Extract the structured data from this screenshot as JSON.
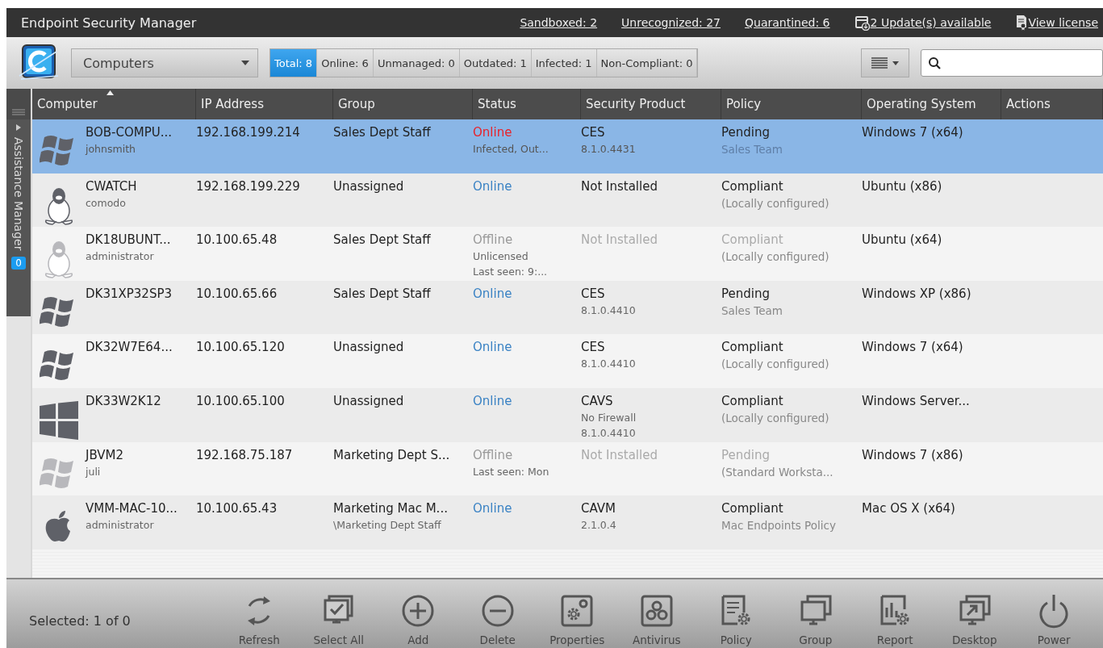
{
  "window": {
    "title": "Endpoint Security Manager"
  },
  "top_links": [
    {
      "kind": "link",
      "label": "Sandboxed: 2"
    },
    {
      "kind": "link",
      "label": "Unrecognized: 27"
    },
    {
      "kind": "link",
      "label": "Quarantined: 6"
    },
    {
      "kind": "updates",
      "label": "2 Update(s) available"
    },
    {
      "kind": "license",
      "label": "View license"
    }
  ],
  "view_select": {
    "value": "Computers"
  },
  "filters": [
    {
      "label": "Total: 8",
      "selected": true
    },
    {
      "label": "Online: 6",
      "selected": false
    },
    {
      "label": "Unmanaged: 0",
      "selected": false
    },
    {
      "label": "Outdated: 1",
      "selected": false
    },
    {
      "label": "Infected: 1",
      "selected": false
    },
    {
      "label": "Non-Compliant: 0",
      "selected": false
    }
  ],
  "sidebar": {
    "label": "Assistance Manager",
    "badge": "0"
  },
  "table": {
    "columns": [
      "Computer",
      "IP Address",
      "Group",
      "Status",
      "Security Product",
      "Policy",
      "Operating System",
      "Actions"
    ],
    "rows": [
      {
        "selected": true,
        "kind": "windows",
        "offline": false,
        "name": "BOB-COMPU...",
        "user": "johnsmith",
        "ip": "192.168.199.214",
        "group": "Sales Dept Staff",
        "group_sub": null,
        "status": {
          "kind": "infected",
          "label": "Online",
          "details": [
            "Infected, Out..."
          ]
        },
        "product": "CES",
        "product_details": [
          "8.1.0.4431"
        ],
        "policy": "Pending",
        "policy_sub": "Sales Team",
        "os": "Windows 7 (x64)"
      },
      {
        "selected": false,
        "kind": "linux",
        "offline": false,
        "name": "CWATCH",
        "user": "comodo",
        "ip": "192.168.199.229",
        "group": "Unassigned",
        "group_sub": null,
        "status": {
          "kind": "online",
          "label": "Online"
        },
        "product": "Not Installed",
        "product_details": [],
        "policy": "Compliant",
        "policy_sub": "(Locally configured)",
        "os": "Ubuntu (x86)"
      },
      {
        "selected": false,
        "kind": "linux",
        "offline": true,
        "name": "DK18UBUNT...",
        "user": "administrator",
        "ip": "10.100.65.48",
        "group": "Sales Dept Staff",
        "group_sub": null,
        "status": {
          "kind": "offline",
          "label": "Offline",
          "details": [
            "Unlicensed",
            "Last seen: 9:..."
          ]
        },
        "product": "Not Installed",
        "product_details": [],
        "policy": "Compliant",
        "policy_sub": "(Locally configured)",
        "os": "Ubuntu (x64)"
      },
      {
        "selected": false,
        "kind": "windows",
        "offline": false,
        "name": "DK31XP32SP3",
        "user": null,
        "ip": "10.100.65.66",
        "group": "Sales Dept Staff",
        "group_sub": null,
        "status": {
          "kind": "online",
          "label": "Online"
        },
        "product": "CES",
        "product_details": [
          "8.1.0.4410"
        ],
        "policy": "Pending",
        "policy_sub": "Sales Team",
        "os": "Windows XP (x86)"
      },
      {
        "selected": false,
        "kind": "windows",
        "offline": false,
        "name": "DK32W7E64...",
        "user": null,
        "ip": "10.100.65.120",
        "group": "Unassigned",
        "group_sub": null,
        "status": {
          "kind": "online",
          "label": "Online"
        },
        "product": "CES",
        "product_details": [
          "8.1.0.4410"
        ],
        "policy": "Compliant",
        "policy_sub": "(Locally configured)",
        "os": "Windows 7 (x64)"
      },
      {
        "selected": false,
        "kind": "tiles",
        "offline": false,
        "name": "DK33W2K12",
        "user": null,
        "ip": "10.100.65.100",
        "group": "Unassigned",
        "group_sub": null,
        "status": {
          "kind": "online",
          "label": "Online"
        },
        "product": "CAVS",
        "product_details": [
          "No Firewall",
          "8.1.0.4410"
        ],
        "policy": "Compliant",
        "policy_sub": "(Locally configured)",
        "os": "Windows Server..."
      },
      {
        "selected": false,
        "kind": "windows",
        "offline": true,
        "name": "JBVM2",
        "user": "juli",
        "ip": "192.168.75.187",
        "group": "Marketing Dept S...",
        "group_sub": null,
        "status": {
          "kind": "offline",
          "label": "Offline",
          "details": [
            "Last seen: Mon"
          ]
        },
        "product": "Not Installed",
        "product_details": [],
        "policy": "Pending",
        "policy_sub": "(Standard Worksta...",
        "os": "Windows 7 (x86)"
      },
      {
        "selected": false,
        "kind": "apple",
        "offline": false,
        "name": "VMM-MAC-10...",
        "user": "administrator",
        "ip": "10.100.65.43",
        "group": "Marketing  Mac M...",
        "group_sub": "\\Marketing Dept Staff",
        "status": {
          "kind": "online",
          "label": "Online"
        },
        "product": "CAVM",
        "product_details": [
          "2.1.0.4"
        ],
        "policy": "Compliant",
        "policy_sub": "Mac Endpoints Policy",
        "os": "Mac OS X (x64)"
      }
    ]
  },
  "status_bar": {
    "selection": "Selected: 1 of 0"
  },
  "actions": [
    {
      "kind": "refresh",
      "label": "Refresh"
    },
    {
      "kind": "selectall",
      "label": "Select All"
    },
    {
      "kind": "add",
      "label": "Add"
    },
    {
      "kind": "delete",
      "label": "Delete"
    },
    {
      "kind": "properties",
      "label": "Properties"
    },
    {
      "kind": "antivirus",
      "label": "Antivirus"
    },
    {
      "kind": "policy",
      "label": "Policy"
    },
    {
      "kind": "group",
      "label": "Group"
    },
    {
      "kind": "report",
      "label": "Report"
    },
    {
      "kind": "desktop",
      "label": "Desktop"
    },
    {
      "kind": "power",
      "label": "Power"
    }
  ]
}
